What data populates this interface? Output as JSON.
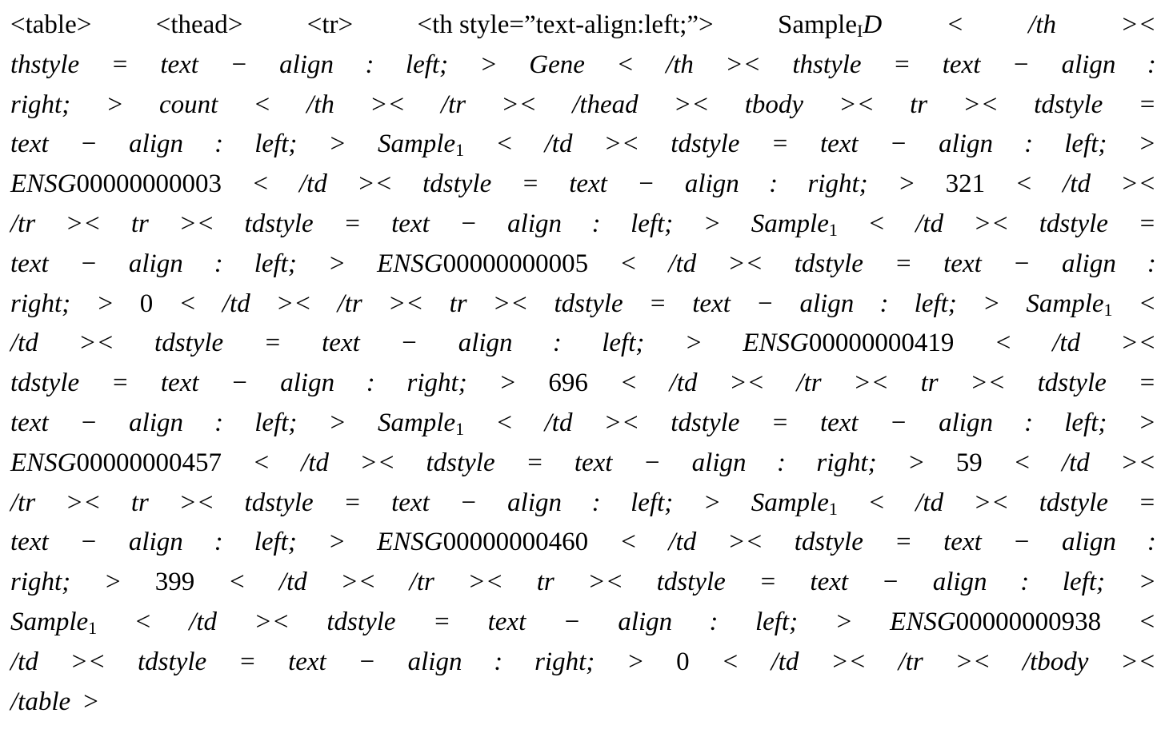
{
  "document": {
    "lines": [
      [
        {
          "t": "<table>",
          "s": "rm"
        },
        {
          "t": "<thead>",
          "s": "rm"
        },
        {
          "t": "<tr>",
          "s": "rm"
        },
        {
          "t": "<th style=”text-align:left;”>",
          "s": "rm"
        },
        {
          "t": "Sample",
          "s": "rm",
          "sub": "I",
          "after": "D"
        },
        {
          "t": "<",
          "s": "it"
        },
        {
          "t": "/th",
          "s": "it"
        },
        {
          "t": "><",
          "s": "it"
        }
      ],
      [
        {
          "t": "thstyle",
          "s": "it"
        },
        {
          "t": "=",
          "s": "it"
        },
        {
          "t": "text",
          "s": "it"
        },
        {
          "t": "−",
          "s": "it"
        },
        {
          "t": "align",
          "s": "it"
        },
        {
          "t": ":",
          "s": "it"
        },
        {
          "t": "left;",
          "s": "it"
        },
        {
          "t": ">",
          "s": "it"
        },
        {
          "t": "Gene",
          "s": "it"
        },
        {
          "t": "<",
          "s": "it"
        },
        {
          "t": "/th",
          "s": "it"
        },
        {
          "t": "><",
          "s": "it"
        },
        {
          "t": "thstyle",
          "s": "it"
        },
        {
          "t": "=",
          "s": "it"
        },
        {
          "t": "text",
          "s": "it"
        },
        {
          "t": "−",
          "s": "it"
        },
        {
          "t": "align",
          "s": "it"
        },
        {
          "t": ":",
          "s": "it"
        }
      ],
      [
        {
          "t": "right;",
          "s": "it"
        },
        {
          "t": ">",
          "s": "it"
        },
        {
          "t": "count",
          "s": "it"
        },
        {
          "t": "<",
          "s": "it"
        },
        {
          "t": "/th",
          "s": "it"
        },
        {
          "t": "><",
          "s": "it"
        },
        {
          "t": "/tr",
          "s": "it"
        },
        {
          "t": "><",
          "s": "it"
        },
        {
          "t": "/thead",
          "s": "it"
        },
        {
          "t": "><",
          "s": "it"
        },
        {
          "t": "tbody",
          "s": "it"
        },
        {
          "t": "><",
          "s": "it"
        },
        {
          "t": "tr",
          "s": "it"
        },
        {
          "t": "><",
          "s": "it"
        },
        {
          "t": "tdstyle",
          "s": "it"
        },
        {
          "t": "=",
          "s": "it"
        }
      ],
      [
        {
          "t": "text",
          "s": "it"
        },
        {
          "t": "−",
          "s": "it"
        },
        {
          "t": "align",
          "s": "it"
        },
        {
          "t": ":",
          "s": "it"
        },
        {
          "t": "left;",
          "s": "it"
        },
        {
          "t": ">",
          "s": "it"
        },
        {
          "t": "Sample",
          "s": "it",
          "sub": "1"
        },
        {
          "t": "<",
          "s": "it"
        },
        {
          "t": "/td",
          "s": "it"
        },
        {
          "t": "><",
          "s": "it"
        },
        {
          "t": "tdstyle",
          "s": "it"
        },
        {
          "t": "=",
          "s": "it"
        },
        {
          "t": "text",
          "s": "it"
        },
        {
          "t": "−",
          "s": "it"
        },
        {
          "t": "align",
          "s": "it"
        },
        {
          "t": ":",
          "s": "it"
        },
        {
          "t": "left;",
          "s": "it"
        },
        {
          "t": ">",
          "s": "it"
        }
      ],
      [
        {
          "t": "ENSG",
          "s": "it",
          "after": "00000000003"
        },
        {
          "t": "<",
          "s": "it"
        },
        {
          "t": "/td",
          "s": "it"
        },
        {
          "t": "><",
          "s": "it"
        },
        {
          "t": "tdstyle",
          "s": "it"
        },
        {
          "t": "=",
          "s": "it"
        },
        {
          "t": "text",
          "s": "it"
        },
        {
          "t": "−",
          "s": "it"
        },
        {
          "t": "align",
          "s": "it"
        },
        {
          "t": ":",
          "s": "it"
        },
        {
          "t": "right;",
          "s": "it"
        },
        {
          "t": ">",
          "s": "it"
        },
        {
          "t": "321",
          "s": "rm"
        },
        {
          "t": "<",
          "s": "it"
        },
        {
          "t": "/td",
          "s": "it"
        },
        {
          "t": "><",
          "s": "it"
        }
      ],
      [
        {
          "t": "/tr",
          "s": "it"
        },
        {
          "t": "><",
          "s": "it"
        },
        {
          "t": "tr",
          "s": "it"
        },
        {
          "t": "><",
          "s": "it"
        },
        {
          "t": "tdstyle",
          "s": "it"
        },
        {
          "t": "=",
          "s": "it"
        },
        {
          "t": "text",
          "s": "it"
        },
        {
          "t": "−",
          "s": "it"
        },
        {
          "t": "align",
          "s": "it"
        },
        {
          "t": ":",
          "s": "it"
        },
        {
          "t": "left;",
          "s": "it"
        },
        {
          "t": ">",
          "s": "it"
        },
        {
          "t": "Sample",
          "s": "it",
          "sub": "1"
        },
        {
          "t": "<",
          "s": "it"
        },
        {
          "t": "/td",
          "s": "it"
        },
        {
          "t": "><",
          "s": "it"
        },
        {
          "t": "tdstyle",
          "s": "it"
        },
        {
          "t": "=",
          "s": "it"
        }
      ],
      [
        {
          "t": "text",
          "s": "it"
        },
        {
          "t": "−",
          "s": "it"
        },
        {
          "t": "align",
          "s": "it"
        },
        {
          "t": ":",
          "s": "it"
        },
        {
          "t": "left;",
          "s": "it"
        },
        {
          "t": ">",
          "s": "it"
        },
        {
          "t": "ENSG",
          "s": "it",
          "after": "00000000005"
        },
        {
          "t": "<",
          "s": "it"
        },
        {
          "t": "/td",
          "s": "it"
        },
        {
          "t": "><",
          "s": "it"
        },
        {
          "t": "tdstyle",
          "s": "it"
        },
        {
          "t": "=",
          "s": "it"
        },
        {
          "t": "text",
          "s": "it"
        },
        {
          "t": "−",
          "s": "it"
        },
        {
          "t": "align",
          "s": "it"
        },
        {
          "t": ":",
          "s": "it"
        }
      ],
      [
        {
          "t": "right;",
          "s": "it"
        },
        {
          "t": ">",
          "s": "it"
        },
        {
          "t": "0",
          "s": "rm"
        },
        {
          "t": "<",
          "s": "it"
        },
        {
          "t": "/td",
          "s": "it"
        },
        {
          "t": "><",
          "s": "it"
        },
        {
          "t": "/tr",
          "s": "it"
        },
        {
          "t": "><",
          "s": "it"
        },
        {
          "t": "tr",
          "s": "it"
        },
        {
          "t": "><",
          "s": "it"
        },
        {
          "t": "tdstyle",
          "s": "it"
        },
        {
          "t": "=",
          "s": "it"
        },
        {
          "t": "text",
          "s": "it"
        },
        {
          "t": "−",
          "s": "it"
        },
        {
          "t": "align",
          "s": "it"
        },
        {
          "t": ":",
          "s": "it"
        },
        {
          "t": "left;",
          "s": "it"
        },
        {
          "t": ">",
          "s": "it"
        },
        {
          "t": "Sample",
          "s": "it",
          "sub": "1"
        },
        {
          "t": "<",
          "s": "it"
        }
      ],
      [
        {
          "t": "/td",
          "s": "it"
        },
        {
          "t": "><",
          "s": "it"
        },
        {
          "t": "tdstyle",
          "s": "it"
        },
        {
          "t": "=",
          "s": "it"
        },
        {
          "t": "text",
          "s": "it"
        },
        {
          "t": "−",
          "s": "it"
        },
        {
          "t": "align",
          "s": "it"
        },
        {
          "t": ":",
          "s": "it"
        },
        {
          "t": "left;",
          "s": "it"
        },
        {
          "t": ">",
          "s": "it"
        },
        {
          "t": "ENSG",
          "s": "it",
          "after": "00000000419"
        },
        {
          "t": "<",
          "s": "it"
        },
        {
          "t": "/td",
          "s": "it"
        },
        {
          "t": "><",
          "s": "it"
        }
      ],
      [
        {
          "t": "tdstyle",
          "s": "it"
        },
        {
          "t": "=",
          "s": "it"
        },
        {
          "t": "text",
          "s": "it"
        },
        {
          "t": "−",
          "s": "it"
        },
        {
          "t": "align",
          "s": "it"
        },
        {
          "t": ":",
          "s": "it"
        },
        {
          "t": "right;",
          "s": "it"
        },
        {
          "t": ">",
          "s": "it"
        },
        {
          "t": "696",
          "s": "rm"
        },
        {
          "t": "<",
          "s": "it"
        },
        {
          "t": "/td",
          "s": "it"
        },
        {
          "t": "><",
          "s": "it"
        },
        {
          "t": "/tr",
          "s": "it"
        },
        {
          "t": "><",
          "s": "it"
        },
        {
          "t": "tr",
          "s": "it"
        },
        {
          "t": "><",
          "s": "it"
        },
        {
          "t": "tdstyle",
          "s": "it"
        },
        {
          "t": "=",
          "s": "it"
        }
      ],
      [
        {
          "t": "text",
          "s": "it"
        },
        {
          "t": "−",
          "s": "it"
        },
        {
          "t": "align",
          "s": "it"
        },
        {
          "t": ":",
          "s": "it"
        },
        {
          "t": "left;",
          "s": "it"
        },
        {
          "t": ">",
          "s": "it"
        },
        {
          "t": "Sample",
          "s": "it",
          "sub": "1"
        },
        {
          "t": "<",
          "s": "it"
        },
        {
          "t": "/td",
          "s": "it"
        },
        {
          "t": "><",
          "s": "it"
        },
        {
          "t": "tdstyle",
          "s": "it"
        },
        {
          "t": "=",
          "s": "it"
        },
        {
          "t": "text",
          "s": "it"
        },
        {
          "t": "−",
          "s": "it"
        },
        {
          "t": "align",
          "s": "it"
        },
        {
          "t": ":",
          "s": "it"
        },
        {
          "t": "left;",
          "s": "it"
        },
        {
          "t": ">",
          "s": "it"
        }
      ],
      [
        {
          "t": "ENSG",
          "s": "it",
          "after": "00000000457"
        },
        {
          "t": "<",
          "s": "it"
        },
        {
          "t": "/td",
          "s": "it"
        },
        {
          "t": "><",
          "s": "it"
        },
        {
          "t": "tdstyle",
          "s": "it"
        },
        {
          "t": "=",
          "s": "it"
        },
        {
          "t": "text",
          "s": "it"
        },
        {
          "t": "−",
          "s": "it"
        },
        {
          "t": "align",
          "s": "it"
        },
        {
          "t": ":",
          "s": "it"
        },
        {
          "t": "right;",
          "s": "it"
        },
        {
          "t": ">",
          "s": "it"
        },
        {
          "t": "59",
          "s": "rm"
        },
        {
          "t": "<",
          "s": "it"
        },
        {
          "t": "/td",
          "s": "it"
        },
        {
          "t": "><",
          "s": "it"
        }
      ],
      [
        {
          "t": "/tr",
          "s": "it"
        },
        {
          "t": "><",
          "s": "it"
        },
        {
          "t": "tr",
          "s": "it"
        },
        {
          "t": "><",
          "s": "it"
        },
        {
          "t": "tdstyle",
          "s": "it"
        },
        {
          "t": "=",
          "s": "it"
        },
        {
          "t": "text",
          "s": "it"
        },
        {
          "t": "−",
          "s": "it"
        },
        {
          "t": "align",
          "s": "it"
        },
        {
          "t": ":",
          "s": "it"
        },
        {
          "t": "left;",
          "s": "it"
        },
        {
          "t": ">",
          "s": "it"
        },
        {
          "t": "Sample",
          "s": "it",
          "sub": "1"
        },
        {
          "t": "<",
          "s": "it"
        },
        {
          "t": "/td",
          "s": "it"
        },
        {
          "t": "><",
          "s": "it"
        },
        {
          "t": "tdstyle",
          "s": "it"
        },
        {
          "t": "=",
          "s": "it"
        }
      ],
      [
        {
          "t": "text",
          "s": "it"
        },
        {
          "t": "−",
          "s": "it"
        },
        {
          "t": "align",
          "s": "it"
        },
        {
          "t": ":",
          "s": "it"
        },
        {
          "t": "left;",
          "s": "it"
        },
        {
          "t": ">",
          "s": "it"
        },
        {
          "t": "ENSG",
          "s": "it",
          "after": "00000000460"
        },
        {
          "t": "<",
          "s": "it"
        },
        {
          "t": "/td",
          "s": "it"
        },
        {
          "t": "><",
          "s": "it"
        },
        {
          "t": "tdstyle",
          "s": "it"
        },
        {
          "t": "=",
          "s": "it"
        },
        {
          "t": "text",
          "s": "it"
        },
        {
          "t": "−",
          "s": "it"
        },
        {
          "t": "align",
          "s": "it"
        },
        {
          "t": ":",
          "s": "it"
        }
      ],
      [
        {
          "t": "right;",
          "s": "it"
        },
        {
          "t": ">",
          "s": "it"
        },
        {
          "t": "399",
          "s": "rm"
        },
        {
          "t": "<",
          "s": "it"
        },
        {
          "t": "/td",
          "s": "it"
        },
        {
          "t": "><",
          "s": "it"
        },
        {
          "t": "/tr",
          "s": "it"
        },
        {
          "t": "><",
          "s": "it"
        },
        {
          "t": "tr",
          "s": "it"
        },
        {
          "t": "><",
          "s": "it"
        },
        {
          "t": "tdstyle",
          "s": "it"
        },
        {
          "t": "=",
          "s": "it"
        },
        {
          "t": "text",
          "s": "it"
        },
        {
          "t": "−",
          "s": "it"
        },
        {
          "t": "align",
          "s": "it"
        },
        {
          "t": ":",
          "s": "it"
        },
        {
          "t": "left;",
          "s": "it"
        },
        {
          "t": ">",
          "s": "it"
        }
      ],
      [
        {
          "t": "Sample",
          "s": "it",
          "sub": "1"
        },
        {
          "t": "<",
          "s": "it"
        },
        {
          "t": "/td",
          "s": "it"
        },
        {
          "t": "><",
          "s": "it"
        },
        {
          "t": "tdstyle",
          "s": "it"
        },
        {
          "t": "=",
          "s": "it"
        },
        {
          "t": "text",
          "s": "it"
        },
        {
          "t": "−",
          "s": "it"
        },
        {
          "t": "align",
          "s": "it"
        },
        {
          "t": ":",
          "s": "it"
        },
        {
          "t": "left;",
          "s": "it"
        },
        {
          "t": ">",
          "s": "it"
        },
        {
          "t": "ENSG",
          "s": "it",
          "after": "00000000938"
        },
        {
          "t": "<",
          "s": "it"
        }
      ],
      [
        {
          "t": "/td",
          "s": "it"
        },
        {
          "t": "><",
          "s": "it"
        },
        {
          "t": "tdstyle",
          "s": "it"
        },
        {
          "t": "=",
          "s": "it"
        },
        {
          "t": "text",
          "s": "it"
        },
        {
          "t": "−",
          "s": "it"
        },
        {
          "t": "align",
          "s": "it"
        },
        {
          "t": ":",
          "s": "it"
        },
        {
          "t": "right;",
          "s": "it"
        },
        {
          "t": ">",
          "s": "it"
        },
        {
          "t": "0",
          "s": "rm"
        },
        {
          "t": "<",
          "s": "it"
        },
        {
          "t": "/td",
          "s": "it"
        },
        {
          "t": "><",
          "s": "it"
        },
        {
          "t": "/tr",
          "s": "it"
        },
        {
          "t": "><",
          "s": "it"
        },
        {
          "t": "/tbody",
          "s": "it"
        },
        {
          "t": "><",
          "s": "it"
        }
      ],
      [
        {
          "t": "/table",
          "s": "it"
        },
        {
          "t": ">",
          "s": "it"
        }
      ]
    ]
  }
}
